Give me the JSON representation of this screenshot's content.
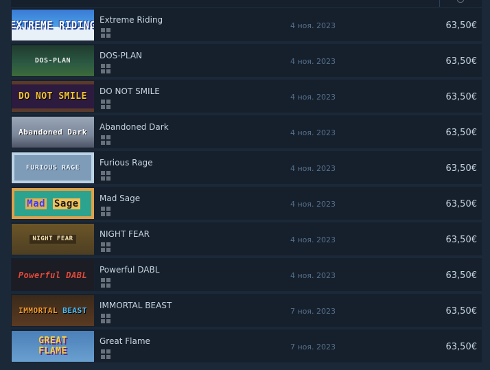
{
  "games": [
    {
      "name": "Extreme Riding",
      "logo": "EXTREME RIDING",
      "date": "4 ноя. 2023",
      "price": "63,50€",
      "platform_icon": "windows-icon"
    },
    {
      "name": "DOS-PLAN",
      "logo": "DOS-PLAN",
      "date": "4 ноя. 2023",
      "price": "63,50€",
      "platform_icon": "windows-icon"
    },
    {
      "name": "DO NOT SMILE",
      "logo": "DO NOT SMILE",
      "date": "4 ноя. 2023",
      "price": "63,50€",
      "platform_icon": "windows-icon"
    },
    {
      "name": "Abandoned Dark",
      "logo": "Abandoned Dark",
      "date": "4 ноя. 2023",
      "price": "63,50€",
      "platform_icon": "windows-icon"
    },
    {
      "name": "Furious Rage",
      "logo": "FURIOUS RAGE",
      "date": "4 ноя. 2023",
      "price": "63,50€",
      "platform_icon": "windows-icon"
    },
    {
      "name": "Mad Sage",
      "logo_a": "Mad",
      "logo_b": "Sage",
      "date": "4 ноя. 2023",
      "price": "63,50€",
      "platform_icon": "windows-icon"
    },
    {
      "name": "NIGHT FEAR",
      "logo": "NIGHT FEAR",
      "date": "4 ноя. 2023",
      "price": "63,50€",
      "platform_icon": "windows-icon"
    },
    {
      "name": "Powerful DABL",
      "logo": "Powerful DABL",
      "date": "4 ноя. 2023",
      "price": "63,50€",
      "platform_icon": "windows-icon"
    },
    {
      "name": "IMMORTAL BEAST",
      "logo_a": "IMMORTAL",
      "logo_b": "BEAST",
      "date": "7 ноя. 2023",
      "price": "63,50€",
      "platform_icon": "windows-icon"
    },
    {
      "name": "Great Flame",
      "logo": "GREAT FLAME",
      "date": "7 ноя. 2023",
      "price": "63,50€",
      "platform_icon": "windows-icon"
    }
  ],
  "colors": {
    "background": "#1b2838",
    "row": "#16202d",
    "name_text": "#c7d5e0",
    "date_text": "#56708a",
    "price_text": "#c7d5e0",
    "platform_icon": "#67707b"
  }
}
